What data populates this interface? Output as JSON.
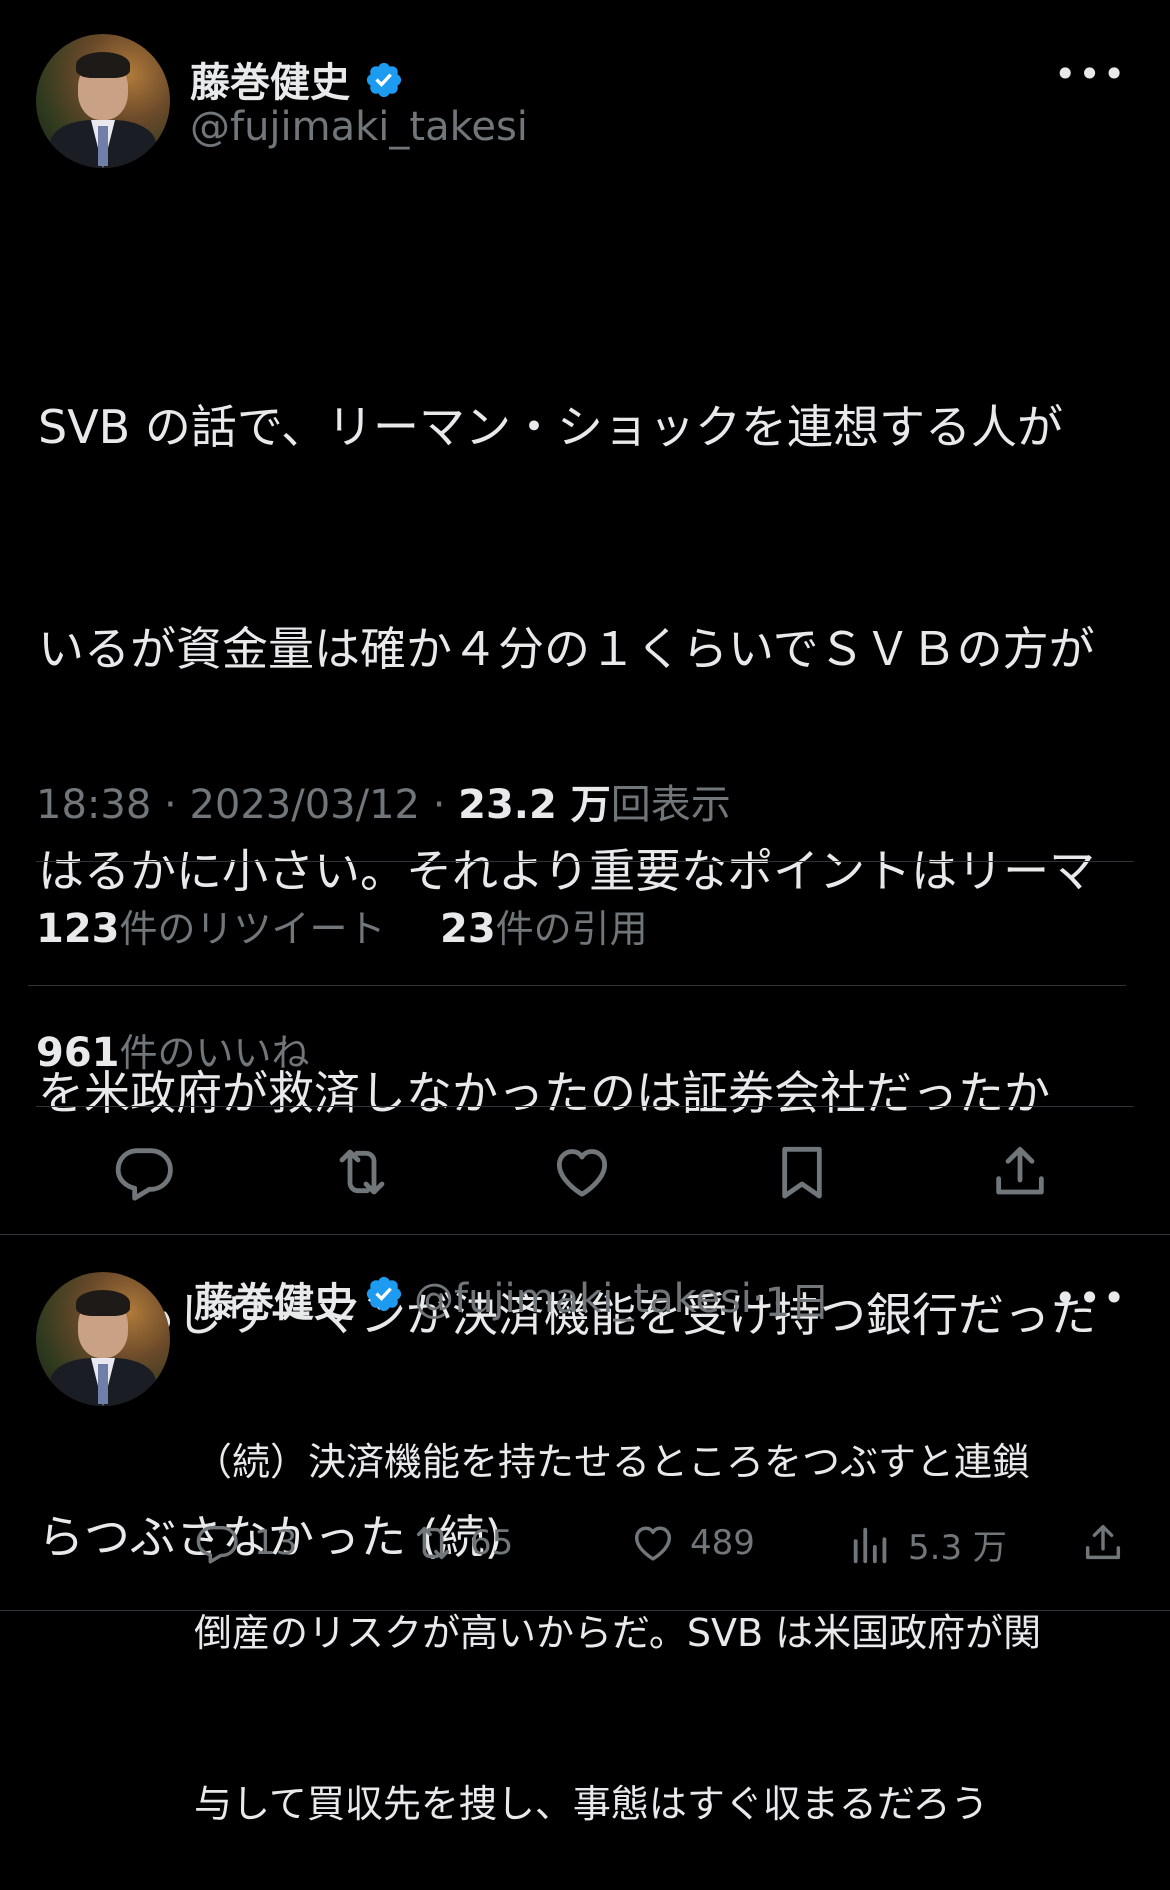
{
  "tweet": {
    "author_name": "藤巻健史",
    "handle": "@fujimaki_takesi",
    "more_label": "•••",
    "lines": [
      "SVB の話で、リーマン・ショックを連想する人が",
      "いるが資金量は確か４分の１くらいでＳＶＢの方が",
      "はるかに小さい。それより重要なポイントはリーマ",
      "を米政府が救済しなかったのは証券会社だったか",
      "ら、もしリーマンが決済機能を受け持つ銀行だった",
      "らつぶさなかった (続)"
    ],
    "time": "18:38",
    "date": "2023/03/12",
    "views_count": "23.2 万",
    "views_label": "回表示",
    "retweets_count": "123",
    "retweets_label": "件のリツイート",
    "quotes_count": "23",
    "quotes_label": "件の引用",
    "likes_count": "961",
    "likes_label": "件のいいね",
    "actions": [
      "reply-icon",
      "retweet-icon",
      "like-icon",
      "bookmark-icon",
      "share-icon"
    ]
  },
  "reply": {
    "author_name": "藤巻健史",
    "handle": "@fujimaki_takesi",
    "age": "1日",
    "more_label": "•••",
    "lines": [
      "（続）決済機能を持たせるところをつぶすと連鎖",
      "倒産のリスクが高いからだ。SVB は米国政府が関",
      "与して買収先を捜し、事態はすぐ収まるだろう"
    ],
    "reply_count": "13",
    "retweet_count": "65",
    "like_count": "489",
    "view_count": "5.3 万"
  },
  "colors": {
    "background": "#000000",
    "text": "#e7e9ea",
    "muted": "#71767b",
    "verified": "#1d9bf0",
    "divider": "#2f3336"
  }
}
